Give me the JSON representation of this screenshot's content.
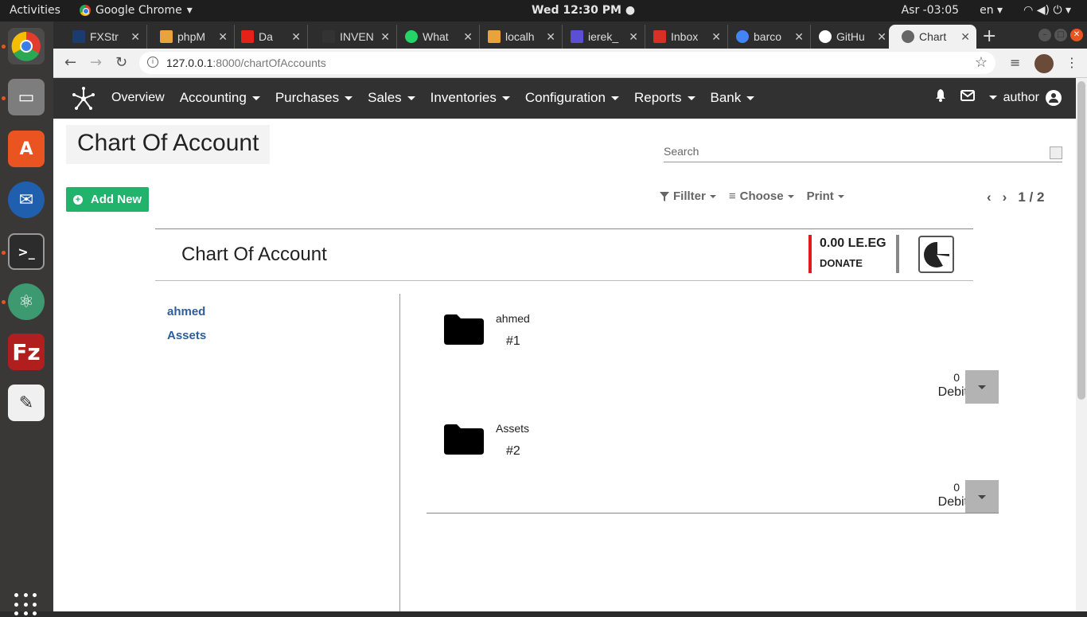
{
  "system": {
    "activities": "Activities",
    "app_name": "Google Chrome",
    "clock": "Wed 12:30 PM",
    "prayer": "Asr -03:05",
    "lang": "en"
  },
  "browser": {
    "tabs": [
      {
        "label": "FXStr",
        "color": "#1c3b6e"
      },
      {
        "label": "phpM",
        "color": "#e8a33d"
      },
      {
        "label": "Da",
        "color": "#e62117"
      },
      {
        "label": "INVEN",
        "color": "#333333"
      },
      {
        "label": "What",
        "color": "#25d366"
      },
      {
        "label": "localh",
        "color": "#e8a33d"
      },
      {
        "label": "ierek_",
        "color": "#5b4fd6"
      },
      {
        "label": "Inbox",
        "color": "#d93025"
      },
      {
        "label": "barco",
        "color": "#4285f4"
      },
      {
        "label": "GitHu",
        "color": "#ffffff"
      },
      {
        "label": "Chart",
        "color": "#666666"
      }
    ],
    "url_host": "127.0.0.1",
    "url_path": ":8000/chartOfAccounts"
  },
  "nav": {
    "items": [
      "Overview",
      "Accounting",
      "Purchases",
      "Sales",
      "Inventories",
      "Configuration",
      "Reports",
      "Bank"
    ],
    "user": "author"
  },
  "page": {
    "title": "Chart Of Account",
    "search_placeholder": "Search",
    "add_new": "Add New",
    "filter": "Fillter",
    "choose": "Choose",
    "print": "Print",
    "pager": "1 / 2",
    "card_title": "Chart Of Account",
    "donate_amount": "0.00  LE.EG",
    "donate_label": "DONATE"
  },
  "sidebar": {
    "items": [
      "ahmed",
      "Assets"
    ]
  },
  "accounts": [
    {
      "name": "ahmed",
      "code": "#1",
      "balance": "0",
      "type": "Debit"
    },
    {
      "name": "Assets",
      "code": "#2",
      "balance": "0",
      "type": "Debit"
    }
  ]
}
